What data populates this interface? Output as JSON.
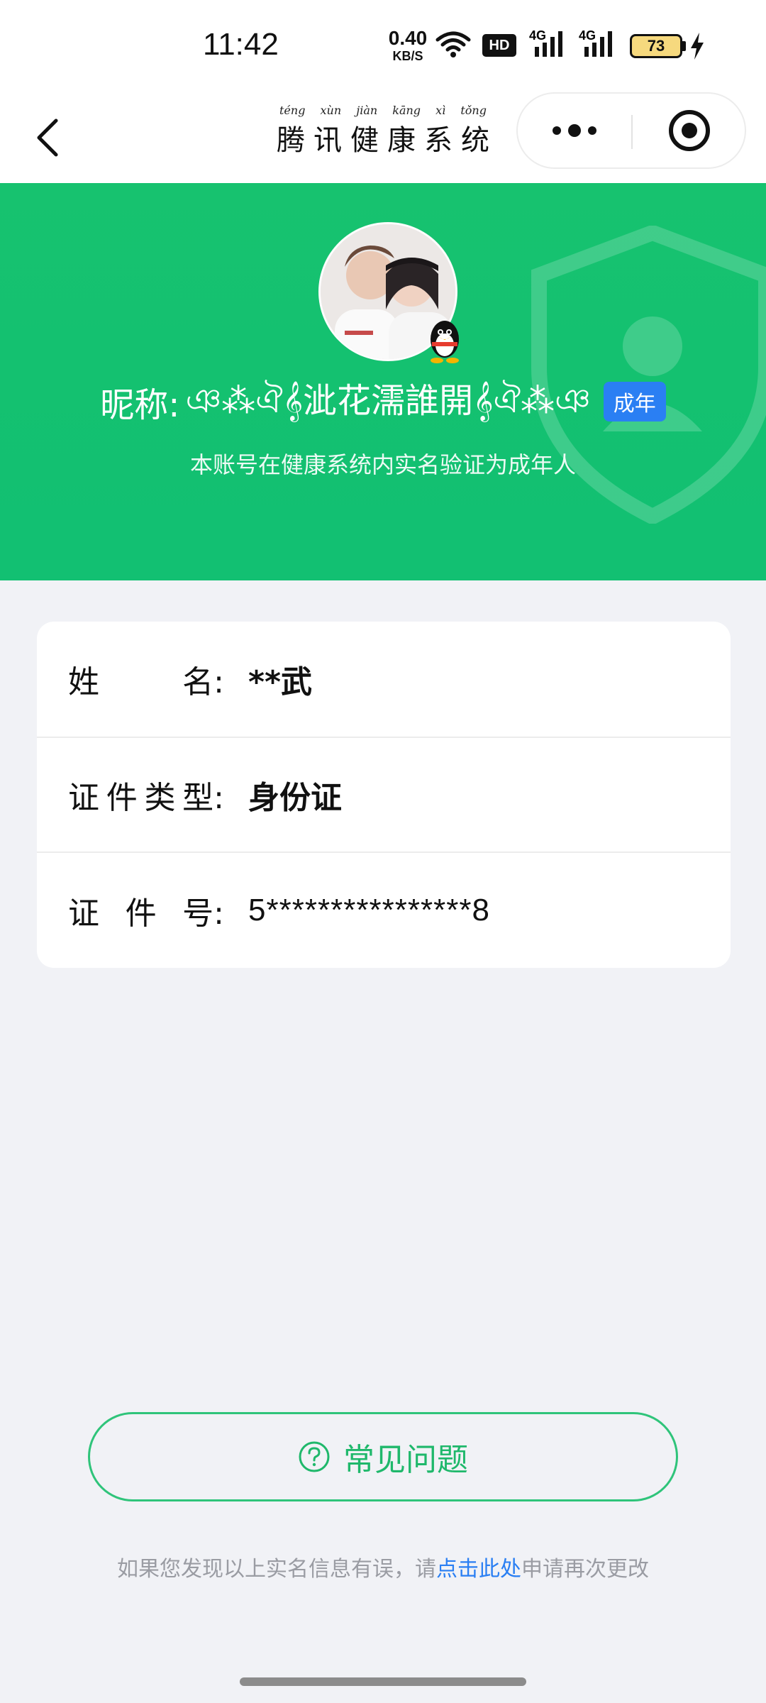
{
  "status_bar": {
    "time": "11:42",
    "net_speed_value": "0.40",
    "net_speed_unit": "KB/S",
    "hd_label": "HD",
    "network_1": "4G",
    "network_2": "4G",
    "battery": "73"
  },
  "nav": {
    "title_pinyin": [
      "téng",
      "xùn",
      "jiàn",
      "kāng",
      "xì",
      "tǒng"
    ],
    "title_hanzi": [
      "腾",
      "讯",
      "健",
      "康",
      "系",
      "统"
    ]
  },
  "profile": {
    "nickname_label": "昵称:",
    "nickname_value": "ঞ⁂ঐ𝄞泚花濡誰開𝄞ঐ⁂ঞ",
    "adult_badge": "成年",
    "verify_text": "本账号在健康系统内实名验证为成年人"
  },
  "info": {
    "rows": [
      {
        "label_chars": [
          "姓",
          "名:"
        ],
        "value": "**武"
      },
      {
        "label_chars": [
          "证",
          "件",
          "类",
          "型:"
        ],
        "value": "身份证"
      },
      {
        "label_chars": [
          "证",
          "件",
          "号:"
        ],
        "value": "5****************8"
      }
    ]
  },
  "faq": {
    "label": "常见问题"
  },
  "footer": {
    "prefix": "如果您发现以上实名信息有误，请",
    "link": "点击此处",
    "suffix": "申请再次更改"
  },
  "colors": {
    "brand_green": "#14c170",
    "badge_blue": "#2a7ff3",
    "link_blue": "#2a7ff3"
  },
  "icons": [
    "back-arrow-icon",
    "more-dots-icon",
    "close-target-icon",
    "qq-penguin-icon",
    "question-circle-icon",
    "wifi-icon",
    "signal-icon",
    "battery-icon",
    "charging-icon"
  ]
}
